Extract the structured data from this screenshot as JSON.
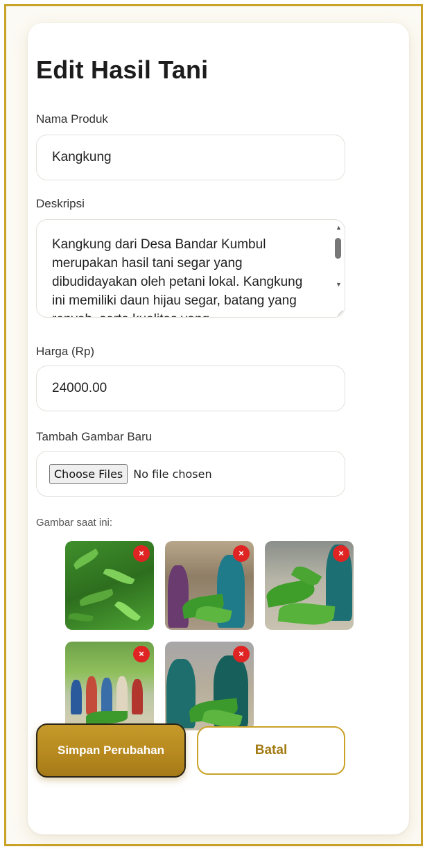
{
  "form": {
    "title": "Edit Hasil Tani",
    "name_label": "Nama Produk",
    "name_value": "Kangkung",
    "desc_label": "Deskripsi",
    "desc_value": "Kangkung dari Desa Bandar Kumbul merupakan hasil tani segar yang dibudidayakan oleh petani lokal. Kangkung ini memiliki daun hijau segar, batang yang renyah, serta kualitas yang",
    "price_label": "Harga (Rp)",
    "price_value": "24000.00",
    "image_label": "Tambah Gambar Baru",
    "choose_files": "Choose Files",
    "no_file": "No file chosen",
    "current_images_label": "Gambar saat ini:",
    "delete_glyph": "×",
    "images": [
      {
        "name": "kangkung-field-photo"
      },
      {
        "name": "farmers-with-kangkung-photo"
      },
      {
        "name": "kangkung-harvest-photo"
      },
      {
        "name": "group-photo-farmers"
      },
      {
        "name": "women-holding-kangkung-photo"
      }
    ],
    "save_button": "Simpan Perubahan",
    "cancel_button": "Batal"
  },
  "colors": {
    "accent_gold": "#c9a227",
    "delete_red": "#e02424"
  }
}
